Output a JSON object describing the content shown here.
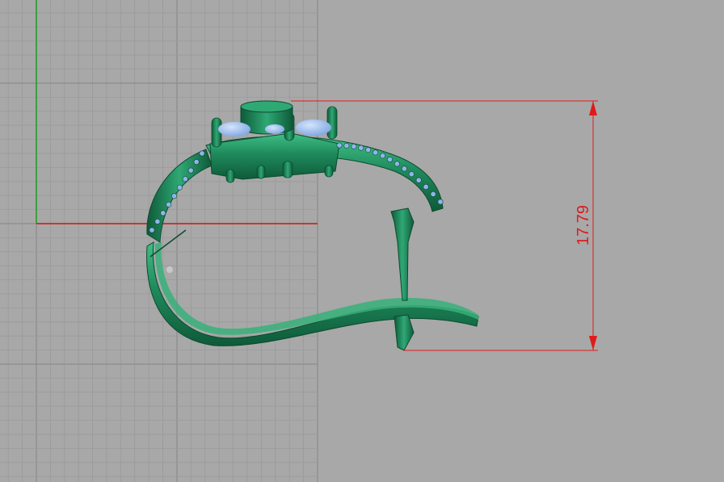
{
  "viewport": {
    "background_color": "#a8a8a8",
    "grid_line_color": "#9a9a9a",
    "grid_major_color": "#8c8c8c",
    "x_axis_color": "#d21414",
    "y_axis_color": "#1ea01e"
  },
  "model": {
    "name": "ring-3d-model",
    "metal_color": "#1f8a5c",
    "metal_highlight_color": "#3fbf86",
    "metal_shadow_color": "#0e5a39",
    "stone_color": "#8fb4ea"
  },
  "dimension": {
    "value": "17.79",
    "color": "#e01a1a"
  }
}
